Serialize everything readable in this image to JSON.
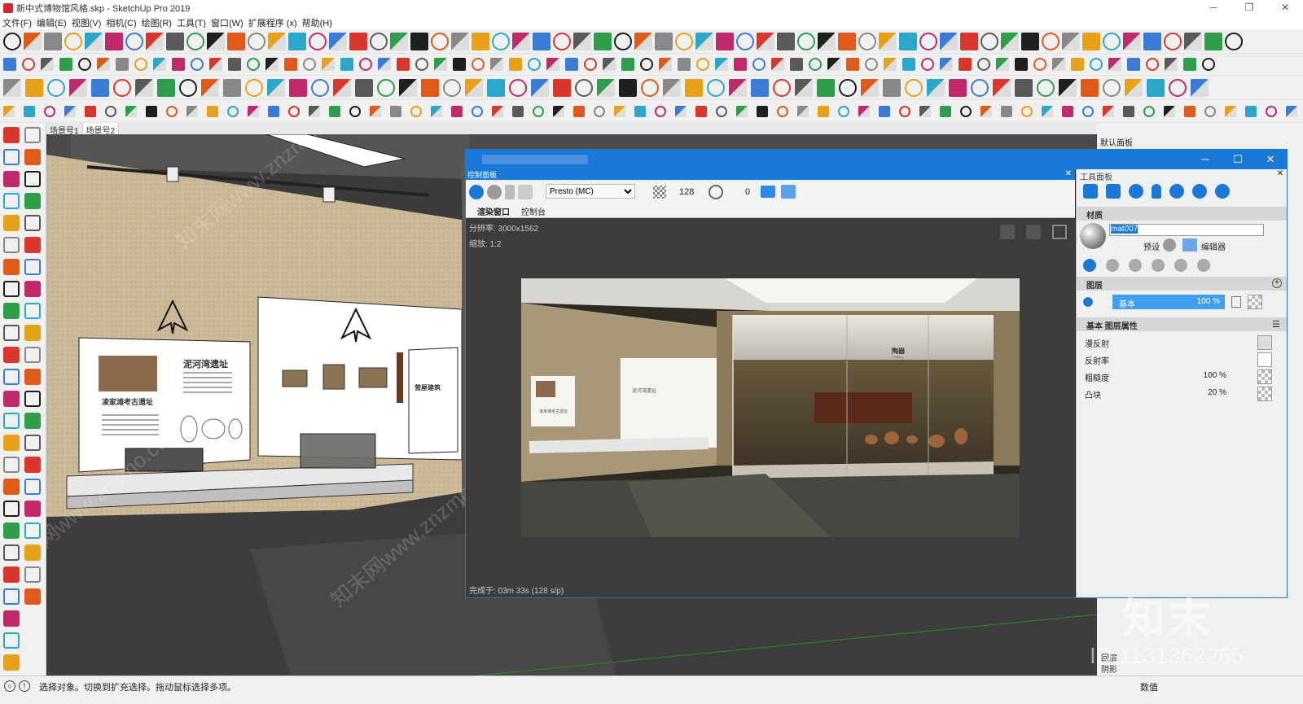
{
  "window": {
    "title": "新中式博物馆风格.skp - SketchUp Pro 2019",
    "controls": [
      "─",
      "❐",
      "✕"
    ]
  },
  "menu": [
    "文件(F)",
    "编辑(E)",
    "视图(V)",
    "相机(C)",
    "绘图(R)",
    "工具(T)",
    "窗口(W)",
    "扩展程序 (x)",
    "帮助(H)"
  ],
  "scene_tabs": [
    "场景号1",
    "场景号2"
  ],
  "status": {
    "text": "选择对象。切换到扩充选择。拖动鼠标选择多项。",
    "measurement_label": "数值"
  },
  "tray": {
    "header": "默认面板"
  },
  "render_window": {
    "controls": [
      "─",
      "☐",
      "✕"
    ],
    "control_panel_label": "控制面板",
    "engine": "Presto (MC)",
    "samples": "128",
    "time": "0",
    "tabs": [
      "渲染窗口",
      "控制台"
    ],
    "resolution": "分辨率:  3000x1562",
    "zoom": "缩放:  1:2",
    "done": "完成于:  03m 33s (128 s/p)"
  },
  "tool_panel": {
    "header": "工具面板",
    "material_title": "材质",
    "material_name": "mat007",
    "preset_label": "预设",
    "editor_label": "编辑器",
    "layers_title": "图层",
    "layer_name": "基本",
    "layer_opacity": "100 %",
    "layer_props_title": "基本 图层属性",
    "props": [
      {
        "label": "漫反射",
        "value": ""
      },
      {
        "label": "反射率",
        "value": ""
      },
      {
        "label": "粗糙度",
        "value": "100 %"
      },
      {
        "label": "凸块",
        "value": "20 %"
      }
    ]
  },
  "scene": {
    "panel1_title": "泥河湾遗址",
    "panel1_sub": "凌家滩考古遗址",
    "panel3_title": "营屋建筑",
    "render_sign": "陶器",
    "render_sign_en": "Pottery",
    "render_panel_title": "泥河湾遗址",
    "render_panel_sub": "凌家滩考古遗址"
  },
  "watermark": {
    "logo": "知末",
    "id": "ID:1131362265",
    "text": "知末网www.znzmo.com",
    "peek": [
      "回层",
      "阴影"
    ]
  },
  "colors": {
    "accent": "#1a78d6",
    "wall": "#c8b48e",
    "floor": "#3b3b3b"
  }
}
